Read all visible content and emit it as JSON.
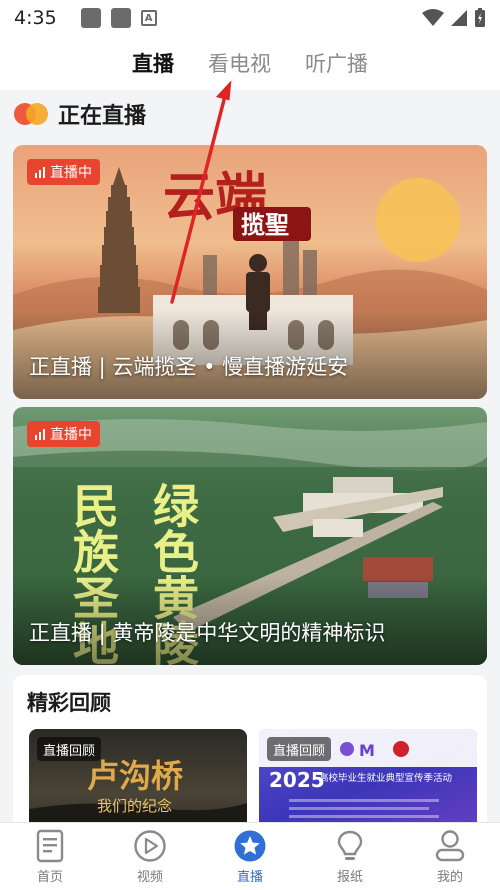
{
  "status_bar": {
    "time": "4:35"
  },
  "top_tabs": [
    {
      "label": "直播",
      "active": true
    },
    {
      "label": "看电视",
      "active": false
    },
    {
      "label": "听广播",
      "active": false
    }
  ],
  "live_section": {
    "title": "正在直播",
    "cards": [
      {
        "badge": "直播中",
        "caption": "正直播 | 云端揽圣 • 慢直播游延安",
        "art_text_1": "云端",
        "art_text_2": "揽聖"
      },
      {
        "badge": "直播中",
        "caption": "正直播 | 黄帝陵是中华文明的精神标识",
        "art_text_1": "民族圣地",
        "art_text_2": "绿色黄陵"
      }
    ]
  },
  "review_section": {
    "title": "精彩回顾",
    "cards": [
      {
        "badge": "直播回顾",
        "art_text_1": "卢沟桥",
        "art_text_2": "我们的纪念"
      },
      {
        "badge": "直播回顾",
        "art_text_1": "2025",
        "art_text_2": "高校毕业生就业典型宣传季活动"
      }
    ]
  },
  "bottom_tabs": [
    {
      "label": "首页",
      "icon": "document-icon",
      "active": false
    },
    {
      "label": "视频",
      "icon": "play-icon",
      "active": false
    },
    {
      "label": "直播",
      "icon": "star-icon",
      "active": true
    },
    {
      "label": "报纸",
      "icon": "bulb-icon",
      "active": false
    },
    {
      "label": "我的",
      "icon": "person-icon",
      "active": false
    }
  ],
  "colors": {
    "live_badge": "#e8452f",
    "accent": "#2f6fd6",
    "arrow": "#e02424"
  }
}
